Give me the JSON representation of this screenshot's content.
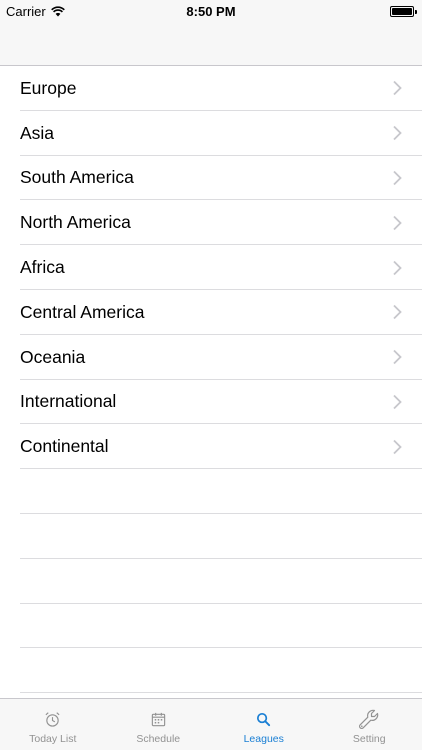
{
  "status_bar": {
    "carrier": "Carrier",
    "time": "8:50 PM"
  },
  "leagues": [
    {
      "label": "Europe"
    },
    {
      "label": "Asia"
    },
    {
      "label": "South America"
    },
    {
      "label": "North America"
    },
    {
      "label": "Africa"
    },
    {
      "label": "Central America"
    },
    {
      "label": "Oceania"
    },
    {
      "label": "International"
    },
    {
      "label": "Continental"
    }
  ],
  "tab_bar": {
    "tabs": [
      {
        "label": "Today List",
        "icon": "alarm-clock-icon",
        "active": false
      },
      {
        "label": "Schedule",
        "icon": "calendar-icon",
        "active": false
      },
      {
        "label": "Leagues",
        "icon": "search-icon",
        "active": true
      },
      {
        "label": "Setting",
        "icon": "wrench-icon",
        "active": false
      }
    ]
  },
  "colors": {
    "accent": "#1a7fd4",
    "inactive": "#929292",
    "chevron": "#c7c7cc"
  }
}
